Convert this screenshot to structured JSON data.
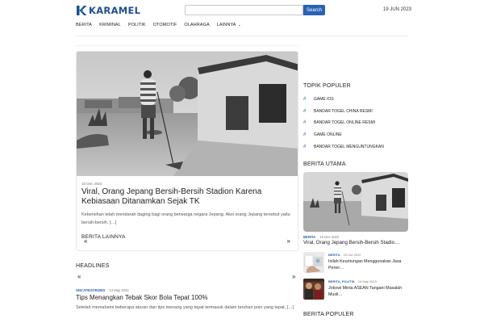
{
  "header": {
    "logo_text": "KARAMEL",
    "search_placeholder": "",
    "search_button": "Search",
    "date": "19 JUN 2023"
  },
  "nav": {
    "items": [
      "BERITA",
      "KRIMINAL",
      "POLITIK",
      "OTOMOTIF",
      "OLAHRAGA",
      "LAINNYA"
    ],
    "more_chevron": "⌄"
  },
  "feature": {
    "date": "10 Dec 2022",
    "title": "Viral, Orang Jepang Bersih-Bersih Stadion Karena Kebiasaan Ditanamkan Sejak TK",
    "excerpt": "Kebersihan telah mendarah daging bagi orang berwarga negara Jepang. Aksi orang Jepang tersebut yaitu bersih-bersih. […]",
    "more_label": "BERITA LAINNYA",
    "prev": "«",
    "next": "»"
  },
  "headlines": {
    "title": "HEADLINES",
    "prev": "«",
    "next": "»",
    "category": "UNCATEGORIZED",
    "date": "13 May 2023",
    "post_title": "Tips Menangkan Tebak Skor Bola Tepat 100%",
    "excerpt": "Setelah memahami beberapa aturan dan tips menang yang tepat termasuk dalam taruhan poin yang tepat, […]"
  },
  "sidebar": {
    "topics_title": "TOPIK POPULER",
    "topics": [
      "GAME IOS",
      "BANDAR TOGEL CHINA RESMI",
      "BANDAR TOGEL ONLINE RESMI",
      "GAME ONLINE",
      "BANDAR TOGEL MENGUNTUNGKAN"
    ],
    "topic_hash": "#",
    "main_title": "BERITA UTAMA",
    "main_category": "BERITA",
    "main_date": "10 Dec 2022",
    "main_post_title": "Viral, Orang Jepang Bersih-Bersih Stadio…",
    "minis": [
      {
        "category": "BERITA",
        "date": "15 Oct 2022",
        "title": "Inilah Keuntungan Menggunakan Jasa Pener…"
      },
      {
        "category": "BERITA, POLITIK",
        "date": "10 May 2023",
        "title": "Jokowi Minta ASEAN Tangani Masalah Musli…"
      }
    ],
    "popular_title": "BERITA POPULER"
  },
  "colors": {
    "accent": "#2a63b3",
    "logo": "#1f4e92"
  }
}
